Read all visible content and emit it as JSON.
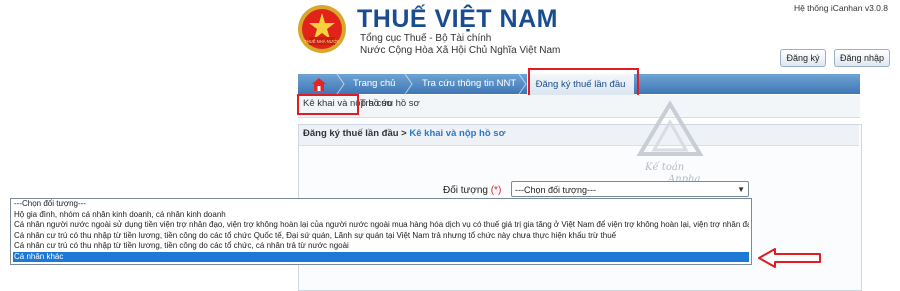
{
  "header": {
    "title": "THUẾ VIỆT NAM",
    "subtitle1": "Tổng cục Thuế - Bộ Tài chính",
    "subtitle2": "Nước Cộng Hòa Xã Hội Chủ Nghĩa Việt Nam",
    "system_version": "Hệ thống iCanhan v3.0.8",
    "emblem_text": "THUẾ NHÀ NƯỚC",
    "register_label": "Đăng ký",
    "login_label": "Đăng nhập"
  },
  "nav": {
    "home_icon": "home-icon",
    "items": [
      "Trang chủ",
      "Tra cứu thông tin NNT",
      "Đăng ký thuế lần đầu"
    ],
    "active_index": 2
  },
  "subnav": {
    "items": [
      "Kê khai và nộp hồ sơ",
      "Tra cứu hồ sơ"
    ]
  },
  "panel": {
    "breadcrumb_root": "Đăng ký thuế lần đầu",
    "breadcrumb_sep": " > ",
    "breadcrumb_current": "Kê khai và nộp hồ sơ",
    "field_label": "Đối tượng",
    "required_mark": "(*)",
    "select_value": "---Chọn đối tượng---"
  },
  "dropdown": {
    "options": [
      "---Chọn đối tượng---",
      "Hộ gia đình, nhóm cá nhân kinh doanh, cá nhân kinh doanh",
      "Cá nhân người nước ngoài sử dụng tiền viện trợ nhân đạo, viện trợ không hoàn lại của người nước ngoài mua hàng hóa dịch vụ có thuế giá trị gia tăng ở Việt Nam để viện trợ không hoàn lại, viện trợ nhân đạo",
      "Cá nhân cư trú có thu nhập từ tiền lương, tiền công do các tổ chức Quốc tế, Đại sứ quán, Lãnh sự quán tại Việt Nam trả nhưng tổ chức này chưa thực hiện khấu trừ thuế",
      "Cá nhân cư trú có thu nhập từ tiền lương, tiền công do các tổ chức, cá nhân trả từ nước ngoài",
      "Cá nhân khác"
    ],
    "selected_index": 5
  },
  "watermark": {
    "text1": "Kế toán",
    "text2": "Anpha"
  },
  "colors": {
    "brand_blue": "#1a4d8f",
    "nav_blue": "#3f77b6",
    "highlight_red": "#e01c24",
    "selection_blue": "#1e78d6"
  }
}
